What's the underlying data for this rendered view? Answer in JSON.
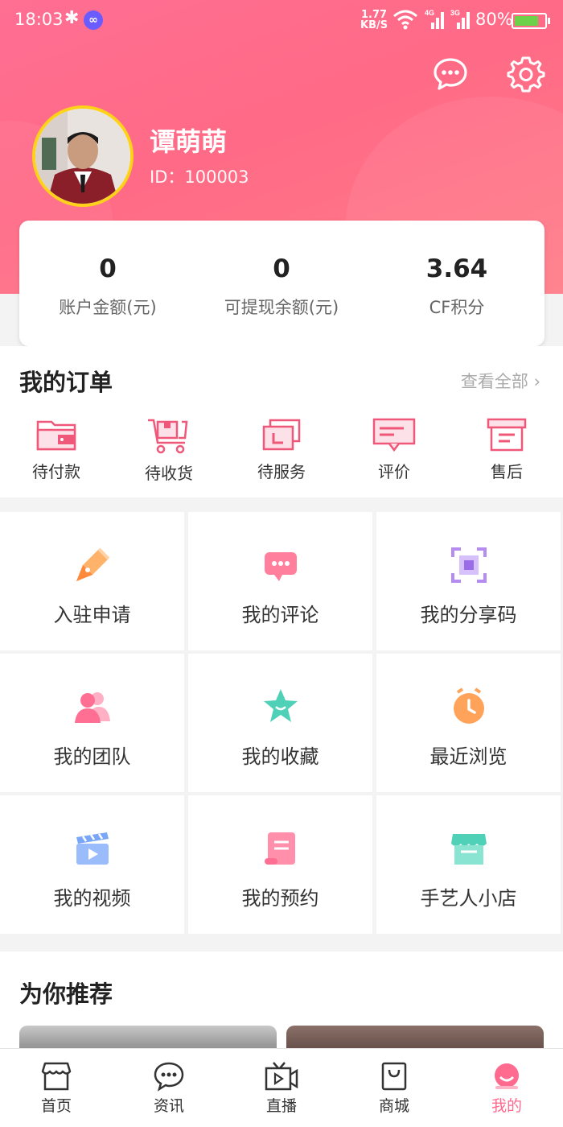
{
  "status_bar": {
    "time": "18:03",
    "net_speed_value": "1.77",
    "net_speed_unit": "KB/S",
    "signal1_label": "4G",
    "signal2_label": "3G",
    "battery": "80%",
    "battery_level": 0.8
  },
  "profile": {
    "name": "谭萌萌",
    "id_text": "ID：100003"
  },
  "balances": [
    {
      "value": "0",
      "label": "账户金额(元)"
    },
    {
      "value": "0",
      "label": "可提现余额(元)"
    },
    {
      "value": "3.64",
      "label": "CF积分"
    }
  ],
  "orders": {
    "title": "我的订单",
    "view_all": "查看全部",
    "items": [
      {
        "label": "待付款",
        "icon": "wallet-icon"
      },
      {
        "label": "待收货",
        "icon": "cart-icon"
      },
      {
        "label": "待服务",
        "icon": "clock-card-icon"
      },
      {
        "label": "评价",
        "icon": "comment-box-icon"
      },
      {
        "label": "售后",
        "icon": "archive-icon"
      }
    ]
  },
  "grid": [
    {
      "label": "入驻申请",
      "icon": "pen-icon"
    },
    {
      "label": "我的评论",
      "icon": "chat-bubble-icon"
    },
    {
      "label": "我的分享码",
      "icon": "qr-scan-icon"
    },
    {
      "label": "我的团队",
      "icon": "team-icon"
    },
    {
      "label": "我的收藏",
      "icon": "star-icon"
    },
    {
      "label": "最近浏览",
      "icon": "clock-icon"
    },
    {
      "label": "我的视频",
      "icon": "clapper-icon"
    },
    {
      "label": "我的预约",
      "icon": "scroll-icon"
    },
    {
      "label": "手艺人小店",
      "icon": "shop-icon"
    }
  ],
  "recommend": {
    "title": "为你推荐"
  },
  "tabbar": [
    {
      "label": "首页",
      "icon": "home-store-icon"
    },
    {
      "label": "资讯",
      "icon": "news-chat-icon"
    },
    {
      "label": "直播",
      "icon": "live-tv-icon"
    },
    {
      "label": "商城",
      "icon": "shopping-bag-icon"
    },
    {
      "label": "我的",
      "icon": "profile-face-icon",
      "active": true
    }
  ],
  "colors": {
    "brand": "#ff6a8f",
    "avatar_ring": "#ffd21a"
  }
}
